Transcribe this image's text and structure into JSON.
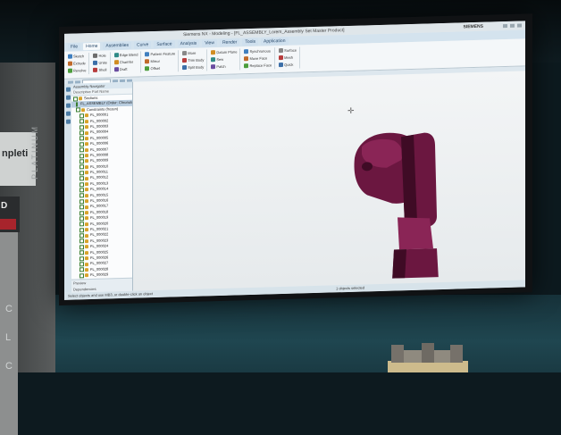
{
  "banner": {
    "text_top": "npleti",
    "logo_text": "D",
    "logo_sub": "PRO",
    "vertical_text": "PLATINUM",
    "glyphs": [
      "C",
      "L",
      "C"
    ]
  },
  "window": {
    "title": "Siemens NX - Modeling - [FL_ASSEMBLY_Lorem_Assembly Set Master Product]",
    "brand": "SIEMENS"
  },
  "menu": {
    "tabs": [
      "File",
      "Home",
      "Assemblies",
      "Curve",
      "Surface",
      "Analysis",
      "View",
      "Render",
      "Tools",
      "Application"
    ],
    "active_index": 1
  },
  "ribbon": {
    "groups": [
      {
        "items": [
          {
            "label": "Sketch",
            "color": "#3f7fbf"
          },
          {
            "label": "Extrude",
            "color": "#c06a2a"
          },
          {
            "label": "Revolve",
            "color": "#4c9d3c"
          }
        ]
      },
      {
        "items": [
          {
            "label": "Hole",
            "color": "#6d6d6d"
          },
          {
            "label": "Unite",
            "color": "#3c6fa8"
          },
          {
            "label": "Shell",
            "color": "#b73b3b"
          }
        ]
      },
      {
        "items": [
          {
            "label": "Edge Blend",
            "color": "#2f8a86"
          },
          {
            "label": "Chamfer",
            "color": "#d18d22"
          },
          {
            "label": "Draft",
            "color": "#6a4ca0"
          }
        ]
      },
      {
        "items": [
          {
            "label": "Pattern Feature",
            "color": "#3f7fbf"
          },
          {
            "label": "Mirror",
            "color": "#c06a2a"
          },
          {
            "label": "Offset",
            "color": "#4c9d3c"
          }
        ]
      },
      {
        "items": [
          {
            "label": "More",
            "color": "#888888"
          },
          {
            "label": "Trim Body",
            "color": "#b73b3b"
          },
          {
            "label": "Split Body",
            "color": "#3c6fa8"
          }
        ]
      },
      {
        "items": [
          {
            "label": "Datum Plane",
            "color": "#d18d22"
          },
          {
            "label": "Sew",
            "color": "#2f8a86"
          },
          {
            "label": "Patch",
            "color": "#6a4ca0"
          }
        ]
      },
      {
        "items": [
          {
            "label": "Synchronous",
            "color": "#3f7fbf"
          },
          {
            "label": "Move Face",
            "color": "#c06a2a"
          },
          {
            "label": "Replace Face",
            "color": "#4c9d3c"
          }
        ]
      },
      {
        "items": [
          {
            "label": "Surface",
            "color": "#888888"
          },
          {
            "label": "Mesh",
            "color": "#b73b3b"
          },
          {
            "label": "Quick",
            "color": "#3c6fa8"
          }
        ]
      }
    ]
  },
  "navigator": {
    "title": "Assembly Navigator",
    "columns": "Descriptive Part Name",
    "rows": [
      "Sections",
      "FL_ASSEMBLY (Order: Chronological)",
      "Constraints (frozen)",
      "FL_000001",
      "FL_000002",
      "FL_000003",
      "FL_000004",
      "FL_000005",
      "FL_000006",
      "FL_000007",
      "FL_000008",
      "FL_000009",
      "FL_000010",
      "FL_000011",
      "FL_000012",
      "FL_000013",
      "FL_000014",
      "FL_000015",
      "FL_000016",
      "FL_000017",
      "FL_000018",
      "FL_000019",
      "FL_000020",
      "FL_000021",
      "FL_000022",
      "FL_000023",
      "FL_000024",
      "FL_000025",
      "FL_000026",
      "FL_000027",
      "FL_000028",
      "FL_000029",
      "FL_000030"
    ],
    "selected_index": 1,
    "footer": [
      "Preview",
      "Dependencies"
    ]
  },
  "status": {
    "message": "Select objects and use MB3, or double-click an object",
    "selection": "1 objects selected"
  },
  "colors": {
    "model": "#6b1740",
    "model_light": "#8a2556",
    "model_dark": "#3f0b25"
  }
}
